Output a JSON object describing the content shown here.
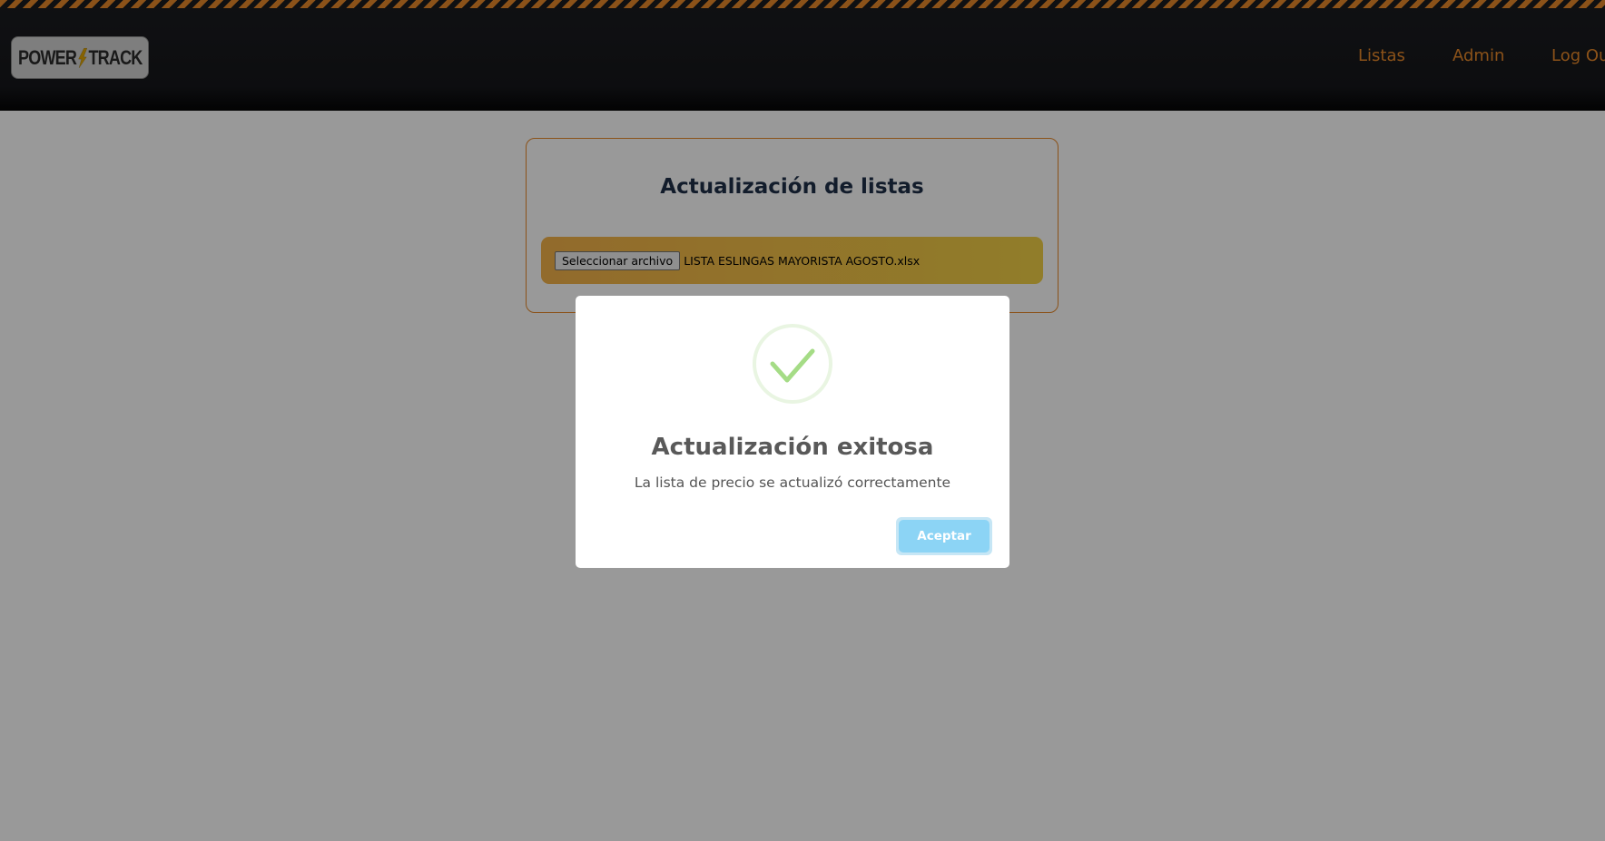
{
  "header": {
    "logo": {
      "left": "POWER",
      "right": "TRACK"
    },
    "nav": [
      {
        "label": "Listas"
      },
      {
        "label": "Admin"
      },
      {
        "label": "Log Ou"
      }
    ]
  },
  "card": {
    "title": "Actualización de listas",
    "file_input": {
      "button_label": "Seleccionar archivo",
      "file_name": "LISTA ESLINGAS MAYORISTA AGOSTO.xlsx"
    }
  },
  "modal": {
    "icon": "success-check-icon",
    "title": "Actualización exitosa",
    "text": "La lista de precio se actualizó correctamente",
    "confirm_label": "Aceptar"
  },
  "colors": {
    "accent": "#e8892a",
    "header_bg": "#16171b",
    "title_text": "#1f3048",
    "success": "#a5dc86",
    "confirm_button": "#8cd4f5"
  }
}
